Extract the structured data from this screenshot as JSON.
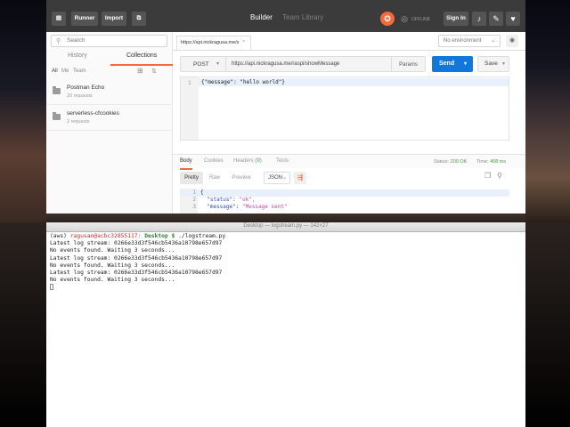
{
  "postman": {
    "toolbar": {
      "runner_label": "Runner",
      "import_label": "Import",
      "builder_label": "Builder",
      "team_library_label": "Team Library",
      "offline_label": "OFFLINE",
      "signin_label": "Sign In"
    },
    "sidebar": {
      "search_placeholder": "Search",
      "tabs": [
        {
          "label": "History"
        },
        {
          "label": "Collections"
        }
      ],
      "filters": [
        {
          "label": "All"
        },
        {
          "label": "Me"
        },
        {
          "label": "Team"
        }
      ],
      "collections": [
        {
          "name": "Postman Echo",
          "count": "20 requests"
        },
        {
          "name": "serverless-cfcookies",
          "count": "2 requests"
        }
      ]
    },
    "request": {
      "tab_label": "https://api.nickragusa.me/s",
      "environment": "No environment",
      "method": "POST",
      "url": "https://api.nickragusa.me/raspi/showMessage",
      "params_label": "Params",
      "send_label": "Send",
      "save_label": "Save",
      "body_line_number": "1",
      "body": "{\"message\": \"hello world\"}"
    },
    "response": {
      "tabs": [
        {
          "label": "Body"
        },
        {
          "label": "Cookies"
        },
        {
          "label": "Headers",
          "count": "(9)"
        },
        {
          "label": "Tests"
        }
      ],
      "status_label": "Status:",
      "status_value": "200 OK",
      "time_label": "Time:",
      "time_value": "408 ms",
      "view_modes": [
        {
          "label": "Pretty"
        },
        {
          "label": "Raw"
        },
        {
          "label": "Preview"
        }
      ],
      "format": "JSON",
      "lines": [
        {
          "num": "1",
          "text": "{"
        },
        {
          "num": "2",
          "key": "\"status\"",
          "value": "\"ok\","
        },
        {
          "num": "3",
          "key": "\"message\"",
          "value": "\"Message sent\""
        }
      ]
    }
  },
  "terminal": {
    "title": "Desktop — logstream.py — 142×27",
    "prompt": {
      "env": "(aws)",
      "user_host": "ragusan@acbc32855117:",
      "path": "Desktop",
      "symbol": "$",
      "command": "./logstream.py"
    },
    "output": [
      "Latest log stream: 0266e33d3f546cb5436a10798e657d97",
      "No events found. Waiting 3 seconds...",
      "Latest log stream: 0266e33d3f546cb5436a10798e657d97",
      "No events found. Waiting 3 seconds...",
      "Latest log stream: 0266e33d3f546cb5436a10798e657d97",
      "No events found. Waiting 3 seconds..."
    ]
  },
  "colors": {
    "accent": "#f26b3a",
    "send": "#1177dd",
    "status_ok": "#4a9a4a"
  }
}
